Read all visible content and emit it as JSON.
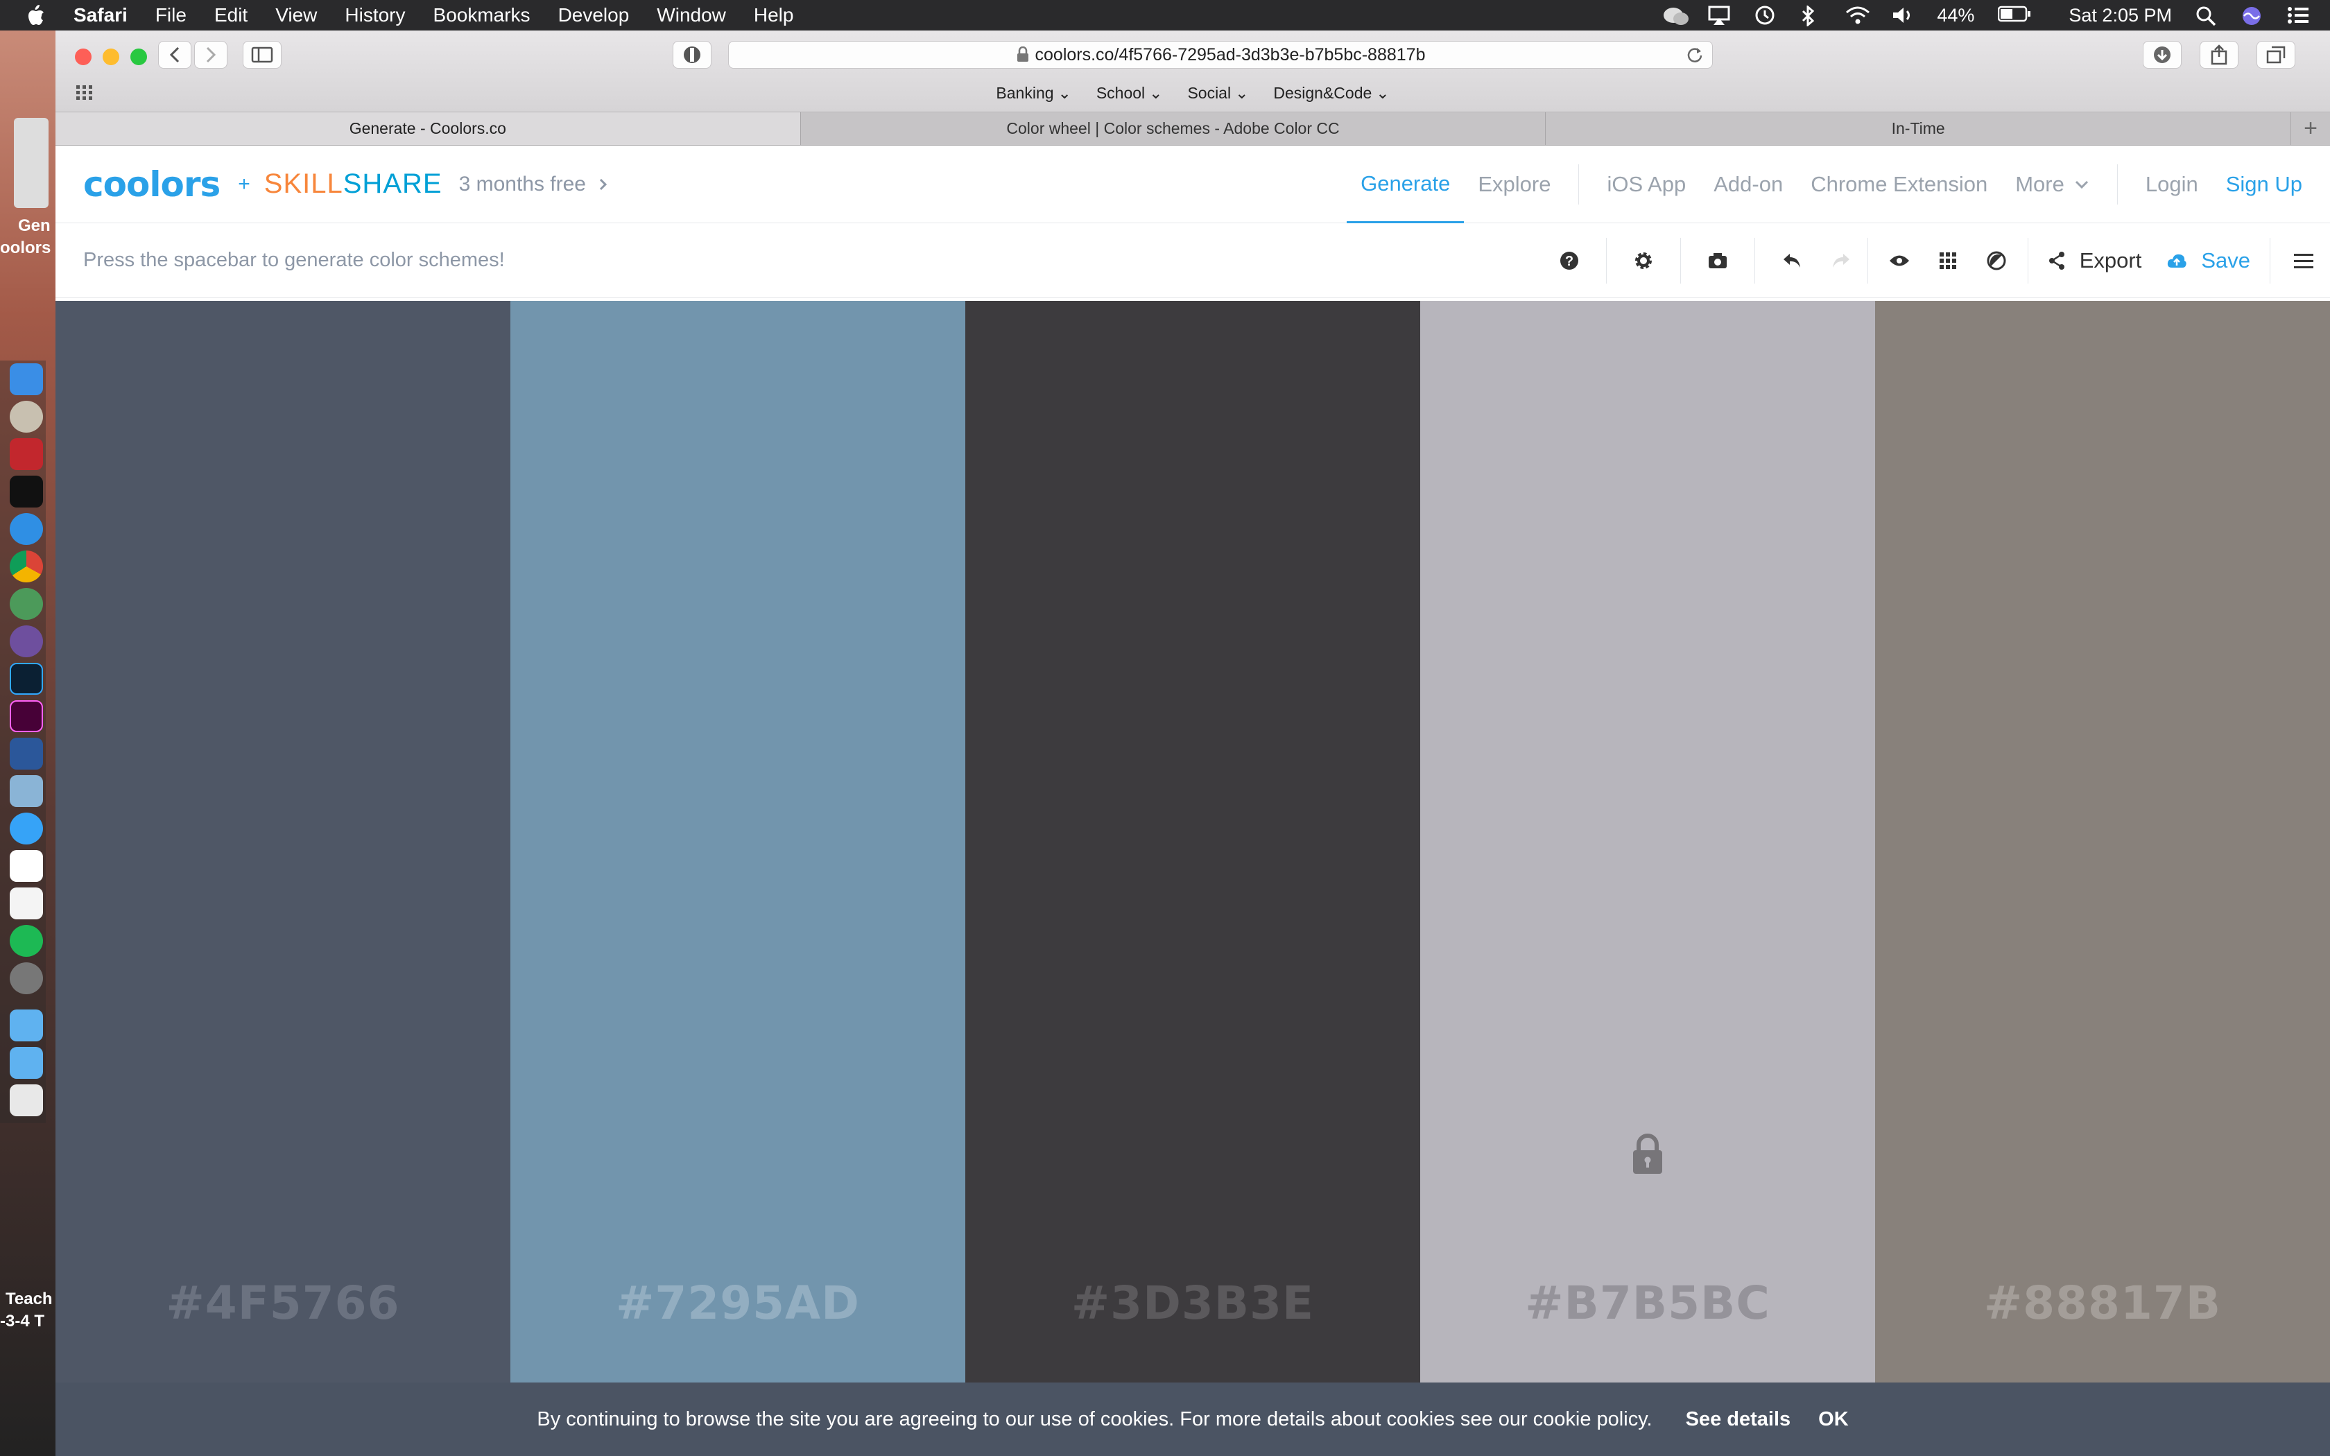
{
  "menubar": {
    "app": "Safari",
    "items": [
      "File",
      "Edit",
      "View",
      "History",
      "Bookmarks",
      "Develop",
      "Window",
      "Help"
    ],
    "battery": "44%",
    "clock": "Sat 2:05 PM"
  },
  "desktop": {
    "label_top_1": "Gen",
    "label_top_2": "oolors",
    "label_bottom_1": "Teach",
    "label_bottom_2": "-3-4 T"
  },
  "browser": {
    "url_host": "coolors.co",
    "url_path": "/4f5766-7295ad-3d3b3e-b7b5bc-88817b",
    "favorites": [
      "Banking",
      "School",
      "Social",
      "Design&Code"
    ],
    "tabs": [
      {
        "label": "Generate - Coolors.co",
        "active": true
      },
      {
        "label": "Color wheel | Color schemes - Adobe Color CC",
        "active": false
      },
      {
        "label": "In-Time",
        "active": false
      }
    ]
  },
  "header": {
    "logo": "coolors",
    "plus": "+",
    "partner_a": "SKILL",
    "partner_b": "SHARE",
    "promo": "3 months free",
    "nav": {
      "generate": "Generate",
      "explore": "Explore",
      "ios_app": "iOS App",
      "addon": "Add-on",
      "chrome_ext": "Chrome Extension",
      "more": "More",
      "login": "Login",
      "signup": "Sign Up"
    }
  },
  "toolbar": {
    "hint": "Press the spacebar to generate color schemes!",
    "export": "Export",
    "save": "Save"
  },
  "palette": [
    {
      "hex": "#4F5766",
      "color": "#4f5766",
      "text_color": "#6b7280",
      "locked": false
    },
    {
      "hex": "#7295AD",
      "color": "#7295ad",
      "text_color": "#93aec1",
      "locked": false
    },
    {
      "hex": "#3D3B3E",
      "color": "#3d3b3e",
      "text_color": "#5b595c",
      "locked": false
    },
    {
      "hex": "#B7B5BC",
      "color": "#b7b5bc",
      "text_color": "#95939a",
      "locked": true
    },
    {
      "hex": "#88817B",
      "color": "#88817b",
      "text_color": "#a49e99",
      "locked": false
    }
  ],
  "cookie": {
    "text": "By continuing to browse the site you are agreeing to our use of cookies. For more details about cookies see our cookie policy.",
    "details": "See details",
    "ok": "OK"
  }
}
